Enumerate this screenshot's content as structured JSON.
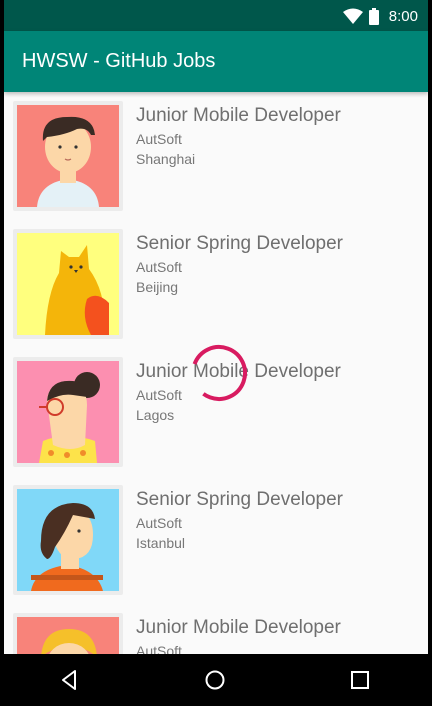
{
  "status_bar": {
    "time": "8:00",
    "icons": [
      "wifi-icon",
      "battery-icon"
    ],
    "background": "#00574b"
  },
  "app_bar": {
    "title": "HWSW - GitHub Jobs",
    "background": "#008577"
  },
  "jobs": [
    {
      "title": "Junior Mobile Developer",
      "company": "AutSoft",
      "location": "Shanghai",
      "avatar": "avatar-boy-salmon"
    },
    {
      "title": "Senior Spring Developer",
      "company": "AutSoft",
      "location": "Beijing",
      "avatar": "avatar-cat-yellow"
    },
    {
      "title": "Junior Mobile Developer",
      "company": "AutSoft",
      "location": "Lagos",
      "avatar": "avatar-woman-glasses-pink"
    },
    {
      "title": "Senior Spring Developer",
      "company": "AutSoft",
      "location": "Istanbul",
      "avatar": "avatar-girl-blue"
    },
    {
      "title": "Junior Mobile Developer",
      "company": "AutSoft",
      "location": "",
      "avatar": "avatar-blond-salmon"
    }
  ],
  "loading_indicator": {
    "visible": true,
    "color": "#d81b60"
  },
  "nav_bar": {
    "buttons": [
      "back-icon",
      "home-icon",
      "recents-icon"
    ]
  }
}
